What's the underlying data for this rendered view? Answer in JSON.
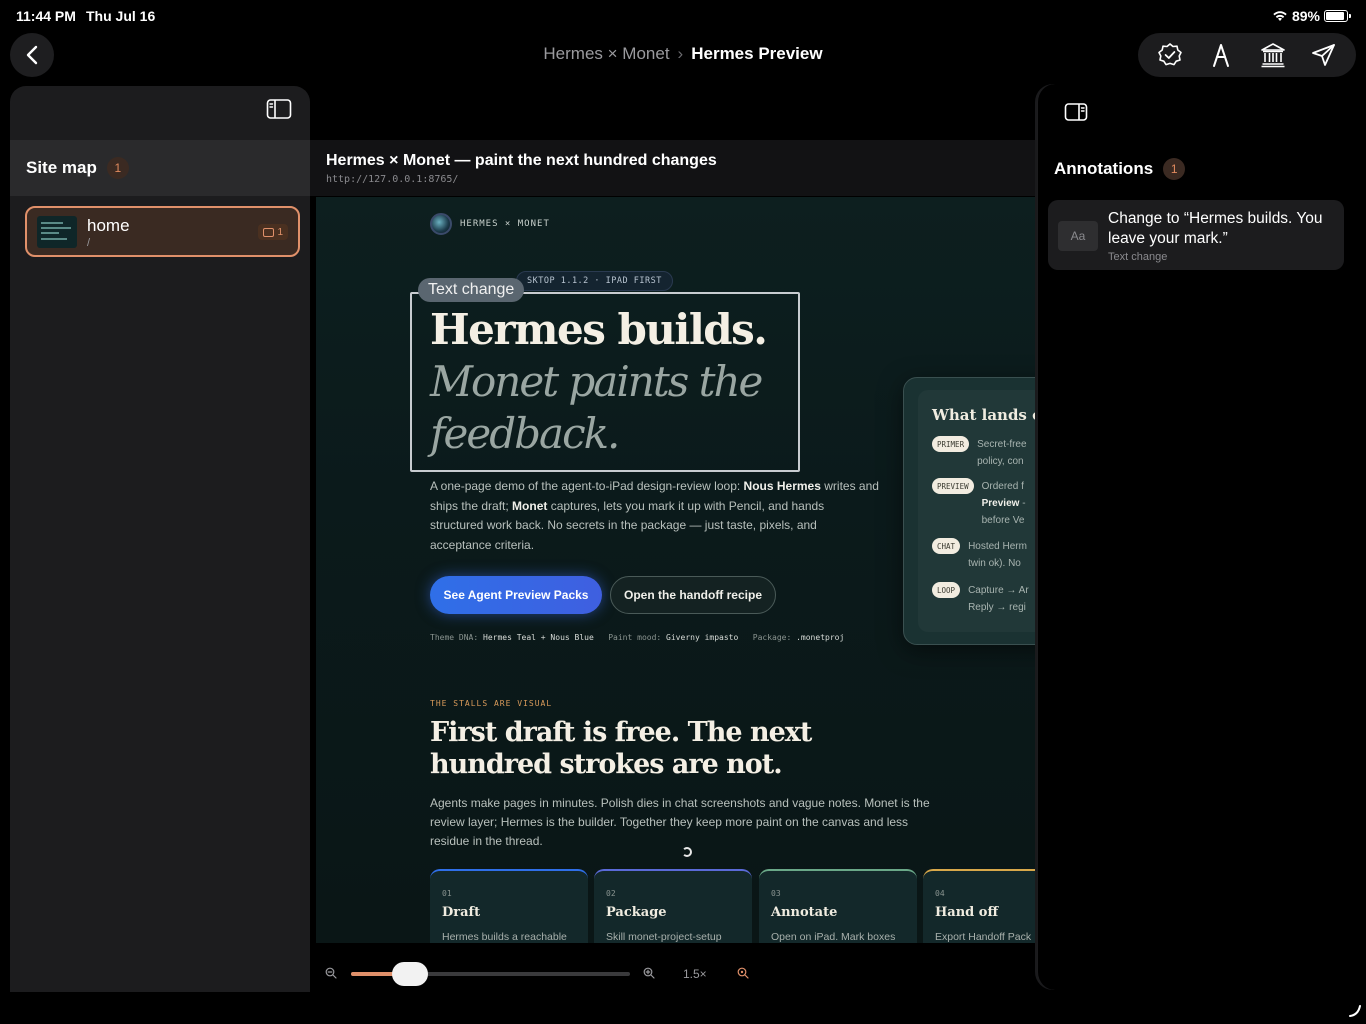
{
  "status": {
    "time": "11:44 PM",
    "date": "Thu Jul 16",
    "battery": "89%",
    "battery_level": 0.89
  },
  "nav": {
    "parent": "Hermes × Monet",
    "separator": "›",
    "current": "Hermes Preview"
  },
  "toolbar": {
    "icons": [
      "verified-badge-icon",
      "pencil-nib-icon",
      "museum-icon",
      "send-icon"
    ]
  },
  "sidebar": {
    "title": "Site map",
    "count": "1",
    "pages": [
      {
        "name": "home",
        "path": "/",
        "annotation_count": "1"
      }
    ]
  },
  "center": {
    "title": "Hermes × Monet — paint the next hundred changes",
    "url": "http://127.0.0.1:8765/"
  },
  "preview": {
    "brand": "HERMES × MONET",
    "version_pill": "SKTOP 1.1.2 · IPAD FIRST",
    "annotation_tag": "Text change",
    "hero_line1": "Hermes builds.",
    "hero_line2": "Monet paints the",
    "hero_line3": "feedback.",
    "intro_a": "A one-page demo of the agent-to-iPad design-review loop: ",
    "intro_hermes": "Nous Hermes",
    "intro_b": " writes and ships the draft; ",
    "intro_monet": "Monet",
    "intro_c": " captures, lets you mark it up with Pencil, and hands structured work back. No secrets in the package — just taste, pixels, and acceptance criteria.",
    "btn_primary": "See Agent Preview Packs",
    "btn_secondary": "Open the handoff recipe",
    "meta_dna_label": "Theme DNA:",
    "meta_dna_value": "Hermes Teal + Nous Blue",
    "meta_mood_label": "Paint mood:",
    "meta_mood_value": "Giverny impasto",
    "meta_pkg_label": "Package:",
    "meta_pkg_value": ".monetproj",
    "kicker": "THE STALLS ARE VISUAL",
    "h2_line1": "First draft is free. The next",
    "h2_line2": "hundred strokes are not.",
    "body2": "Agents make pages in minutes. Polish dies in chat screenshots and vague notes. Monet is the review layer; Hermes is the builder. Together they keep more paint on the canvas and less residue in the thread.",
    "steps": [
      {
        "num": "01",
        "title": "Draft",
        "desc": "Hermes builds a reachable",
        "color": "#2f6fe8"
      },
      {
        "num": "02",
        "title": "Package",
        "desc": "Skill monet-project-setup",
        "color": "#5a6ad8"
      },
      {
        "num": "03",
        "title": "Annotate",
        "desc": "Open on iPad. Mark boxes",
        "color": "#6aa888"
      },
      {
        "num": "04",
        "title": "Hand off",
        "desc": "Export Handoff Pack",
        "color": "#d8a84a"
      }
    ],
    "side_card": {
      "title": "What lands on",
      "rows": [
        {
          "pill": "PRIMER",
          "l1": "Secret-free",
          "l2": "policy, con",
          "bold": ""
        },
        {
          "pill": "PREVIEW",
          "l1": "Ordered f",
          "l2": "- ",
          "bold": "Preview",
          "l3": "before Ve"
        },
        {
          "pill": "CHAT",
          "l1": "Hosted Herm",
          "l2": "twin ok). No",
          "bold": ""
        },
        {
          "pill": "LOOP",
          "l1": "Capture → Ar",
          "l2": "Reply → regi",
          "bold": ""
        }
      ]
    }
  },
  "zoom": {
    "label": "1.5×",
    "level": 0.21
  },
  "annotations": {
    "title": "Annotations",
    "count": "1",
    "items": [
      {
        "icon": "Aa",
        "text": "Change to “Hermes builds. You leave your mark.”",
        "type": "Text change"
      }
    ]
  },
  "colors": {
    "accent": "#e0906a",
    "primary_blue": "#2f6fe8",
    "panel": "#1c1c1e"
  }
}
